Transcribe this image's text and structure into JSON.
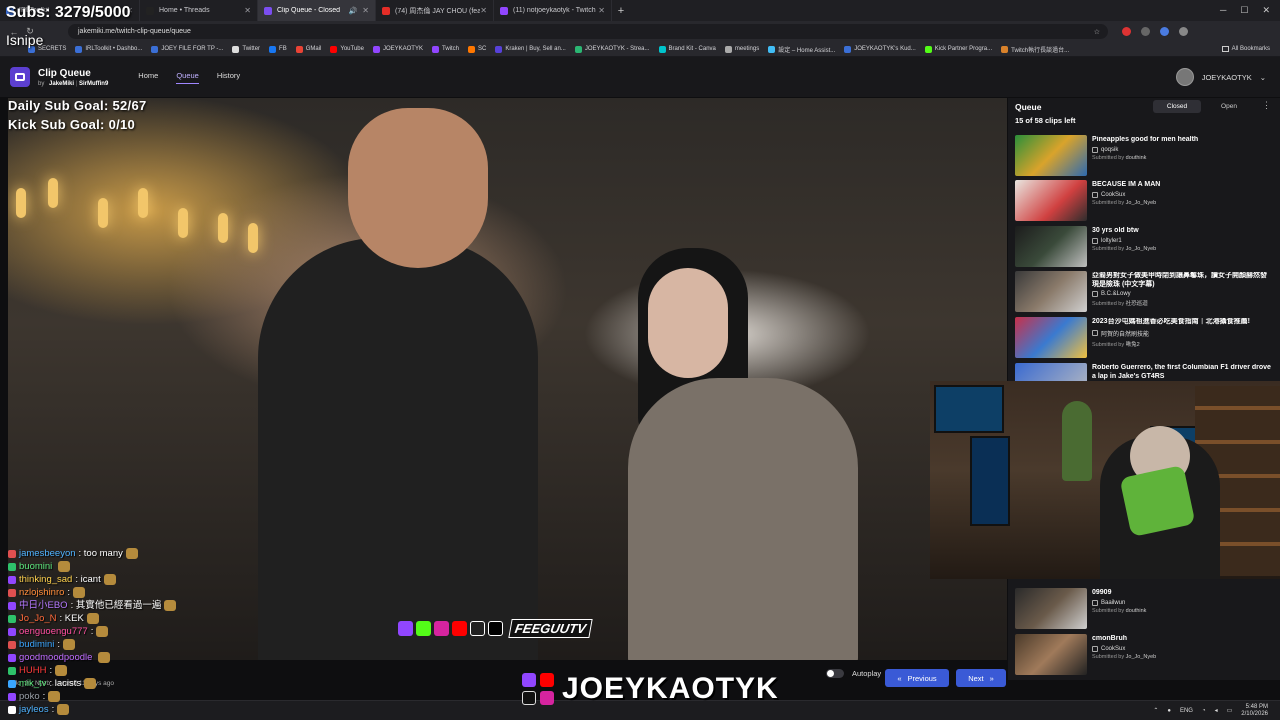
{
  "overlay": {
    "subs": "Subs: 3279/5000",
    "isnipe": "Isnipe",
    "daily_goal": "Daily Sub Goal: 52/67",
    "kick_goal": "Kick Sub Goal: 0/10"
  },
  "browser": {
    "tabs": [
      {
        "label": "IRLToolkit",
        "color": "#3b6fd6",
        "active": false
      },
      {
        "label": "Home • Threads",
        "color": "#222222",
        "active": false
      },
      {
        "label": "Clip Queue - Closed",
        "color": "#7b4ef0",
        "active": true
      },
      {
        "label": "(74) 周杰倫 JAY CHOU (feat. 蔡",
        "color": "#e52d27",
        "active": false
      },
      {
        "label": "(11) notjoeykaotyk - Twitch",
        "color": "#9146ff",
        "active": false
      }
    ],
    "new_tab": "+",
    "url": "jakemiki.me/twitch-clip-queue/queue",
    "bookmarks": [
      {
        "label": "SECRETS",
        "color": "#3b6fd6"
      },
      {
        "label": "IRLToolkit • Dashbo...",
        "color": "#3b6fd6"
      },
      {
        "label": "JOEY FILE FOR TP -...",
        "color": "#3b6fd6"
      },
      {
        "label": "Twitter",
        "color": "#dddddd"
      },
      {
        "label": "FB",
        "color": "#1877f2"
      },
      {
        "label": "GMail",
        "color": "#ea4335"
      },
      {
        "label": "YouTube",
        "color": "#ff0000"
      },
      {
        "label": "JOEYKAOTYK",
        "color": "#9146ff"
      },
      {
        "label": "Twitch",
        "color": "#9146ff"
      },
      {
        "label": "SC",
        "color": "#ff7700"
      },
      {
        "label": "Kraken | Buy, Sell an...",
        "color": "#5741d9"
      },
      {
        "label": "JOEYKAOTYK - Strea...",
        "color": "#2bb673"
      },
      {
        "label": "Brand Kit - Canva",
        "color": "#00c4cc"
      },
      {
        "label": "meetings",
        "color": "#aaaaaa"
      },
      {
        "label": "設定 – Home Assist...",
        "color": "#41bdf5"
      },
      {
        "label": "JOEYKAOTYK's Kud...",
        "color": "#3b6fd6"
      },
      {
        "label": "Kick Partner Progra...",
        "color": "#53fc18"
      },
      {
        "label": "Twitch執行長談過台...",
        "color": "#d9822b"
      }
    ],
    "all_bookmarks": "All Bookmarks"
  },
  "app": {
    "title": "Clip Queue",
    "by_prefix": "by",
    "author1": "JakeMiki",
    "author2": "SirMuffin9",
    "nav": [
      "Home",
      "Queue",
      "History"
    ],
    "active_nav": "Queue",
    "user": "JOEYKAOTYK",
    "accent": "#9f86ff"
  },
  "chat": [
    {
      "user": "jamesbeeyon",
      "color": "#4fb3ff",
      "msg": ": too many",
      "badge": "#e05050"
    },
    {
      "user": "buomini",
      "color": "#5ee87e",
      "msg": "",
      "badge": "#2ec26a"
    },
    {
      "user": "thinking_sad",
      "color": "#ffd24f",
      "msg": ": icant",
      "badge": "#9146ff"
    },
    {
      "user": "nzlojshinro",
      "color": "#ff8c3a",
      "msg": ":",
      "badge": "#e05050"
    },
    {
      "user": "中日小EBO",
      "color": "#b478ff",
      "msg": ": 其實他已經看過一遍",
      "badge": "#9146ff"
    },
    {
      "user": "Jo_Jo_N",
      "color": "#ff6a3a",
      "msg": ": KEK",
      "badge": "#2ec26a"
    },
    {
      "user": "oenguoengu777",
      "color": "#ff4fa0",
      "msg": ":",
      "badge": "#9146ff"
    },
    {
      "user": "budimini",
      "color": "#3aa6ff",
      "msg": ":",
      "badge": "#e05050"
    },
    {
      "user": "goodmoodpoodle",
      "color": "#c06cff",
      "msg": "",
      "badge": "#9146ff"
    },
    {
      "user": "HUHH",
      "color": "#ff3a3a",
      "msg": ":",
      "badge": "#2ec26a"
    },
    {
      "user": "mik_tv",
      "color": "#5ee87e",
      "msg": ": lacists",
      "badge": "#3aa6ff"
    },
    {
      "user": "poko",
      "color": "#9aa0a8",
      "msg": ":",
      "badge": "#9146ff"
    },
    {
      "user": "jayleos",
      "color": "#4fb3ff",
      "msg": ":",
      "badge": "#ffffff"
    }
  ],
  "clip": {
    "meta": "Jo_Jo_Nyeb , created 11 days ago"
  },
  "controls": {
    "autoplay": "Autoplay",
    "previous": "Previous",
    "next": "Next"
  },
  "brand": {
    "name": "JOEYKAOTYK",
    "feeguu": "FEEGUUTV"
  },
  "queue": {
    "title": "Queue",
    "count": "15 of 58 clips left",
    "tabs": [
      "Closed",
      "Open"
    ],
    "active_tab": "Closed",
    "items": [
      {
        "title": "Pineapples good for men health",
        "author": "qoqsik",
        "submitter": "douthink",
        "thumb": "linear-gradient(135deg,#2a8f3a,#d9a32b 50%,#2d6ab0)"
      },
      {
        "title": "BECAUSE IM A MAN",
        "author": "CookSux",
        "submitter": "Jo_Jo_Nyeb",
        "thumb": "linear-gradient(135deg,#e9e6e0,#d04040 60%,#2d2d2d)"
      },
      {
        "title": "30 yrs old btw",
        "author": "loltyler1",
        "submitter": "Jo_Jo_Nyeb",
        "thumb": "linear-gradient(135deg,#1c1c1c,#3a4a3a 50%,#c0c0c0)"
      },
      {
        "title": "亞裔男對女子做美甲時閉到讓鼻鬈珠，讀女子開顏赫然發現是險珠 (中文字幕)",
        "author": "B.C.&Lowy",
        "submitter": "社恐巡迴",
        "thumb": "linear-gradient(135deg,#3a3a3a,#8a7a6a 50%,#d0d0d0)"
      },
      {
        "title": "2023台沙屯媽祖進香必吃美食指南｜北港攝食推薦!",
        "author": "阿賀的自然刷技能",
        "submitter": "啾兔2",
        "thumb": "linear-gradient(135deg,#c8304a,#3a7ad0 50%,#f0c040)"
      },
      {
        "title": "Roberto Guerrero, the first Columbian F1 driver drove a lap in Jake's GT4RS",
        "author": "",
        "submitter": "",
        "thumb": "linear-gradient(135deg,#3a6ad0,#c0c0c0)"
      },
      {
        "title": "09909",
        "author": "Baailwun",
        "submitter": "douthink",
        "thumb": "linear-gradient(135deg,#2a2a2a,#6a5a4a 50%,#cfcfcf)"
      },
      {
        "title": "cmonBruh",
        "author": "CookSux",
        "submitter": "Jo_Jo_Nyeb",
        "thumb": "linear-gradient(135deg,#4a3a2a,#a07a5a 50%,#222)"
      }
    ],
    "submitted_by": "Submitted by"
  },
  "taskbar": {
    "lang": "ENG",
    "time": "5:48 PM",
    "date": "2/10/2026"
  }
}
